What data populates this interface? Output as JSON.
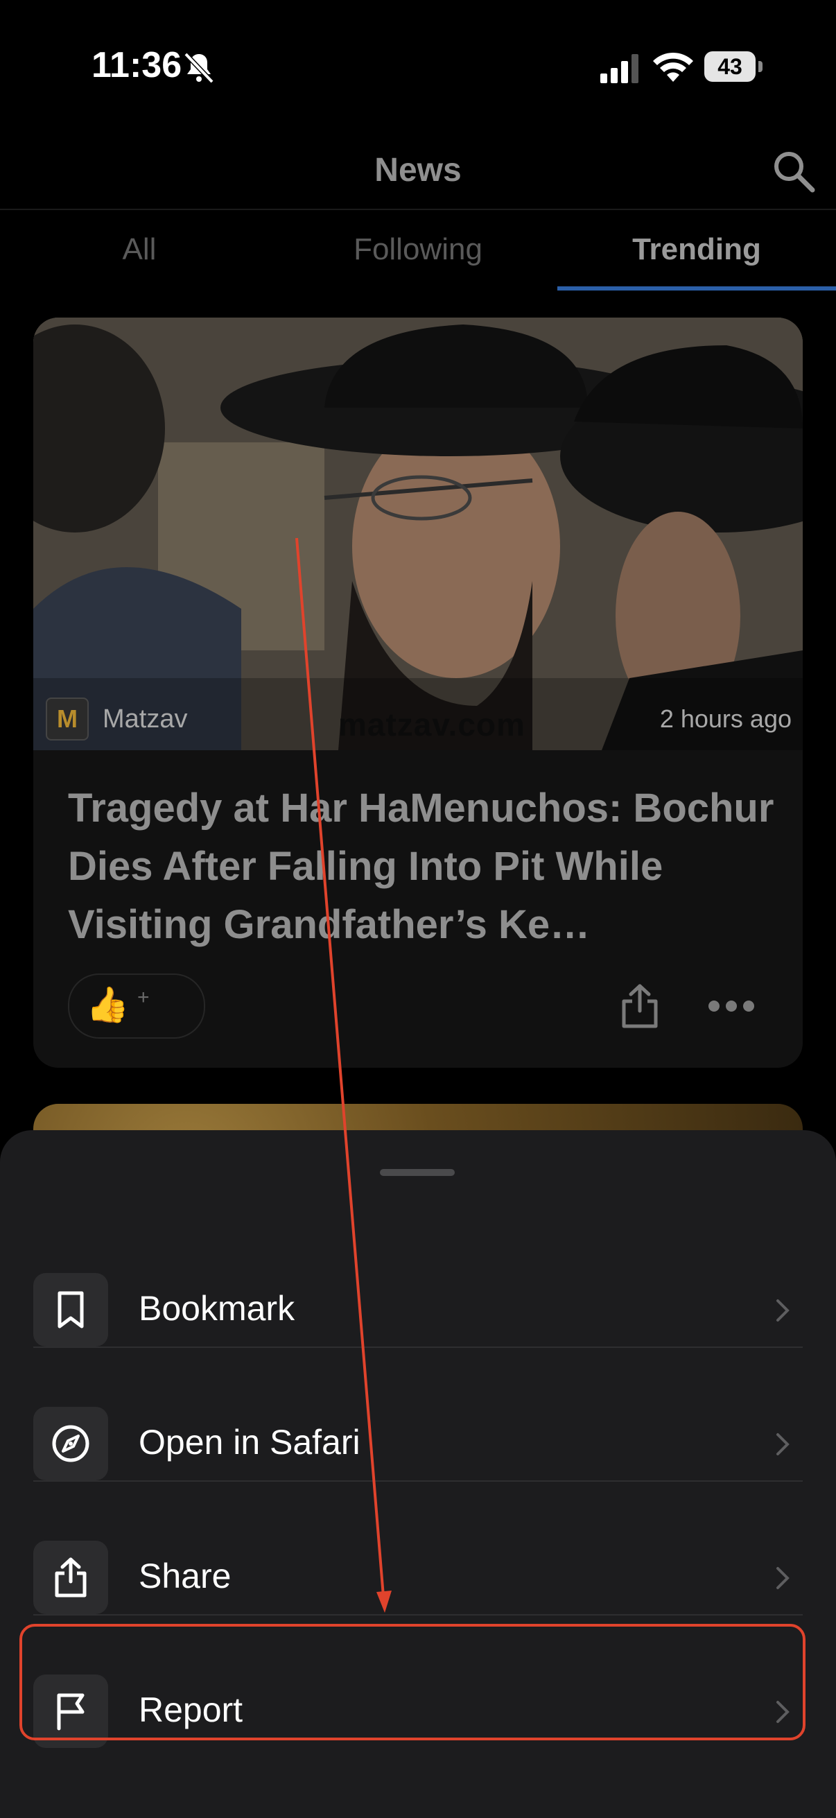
{
  "status_bar": {
    "time": "11:36",
    "battery": "43"
  },
  "header": {
    "title": "News"
  },
  "tabs": [
    {
      "label": "All",
      "active": false
    },
    {
      "label": "Following",
      "active": false
    },
    {
      "label": "Trending",
      "active": true
    }
  ],
  "article": {
    "source": "Matzav",
    "source_logo": "M",
    "time_ago": "2 hours ago",
    "watermark": "matzav.com",
    "headline": "Tragedy at Har HaMenuchos: Bochur Dies After Falling Into Pit While Visiting Grandfather’s Ke…",
    "reaction_emoji": "👍",
    "reaction_plus": "+"
  },
  "sheet": {
    "items": [
      {
        "label": "Bookmark",
        "icon": "bookmark-icon"
      },
      {
        "label": "Open in Safari",
        "icon": "compass-icon"
      },
      {
        "label": "Share",
        "icon": "share-icon"
      },
      {
        "label": "Report",
        "icon": "flag-icon"
      }
    ]
  },
  "colors": {
    "accent": "#2b5fa8",
    "annotation": "#e0432c",
    "sheet_bg": "#1c1c1e"
  }
}
